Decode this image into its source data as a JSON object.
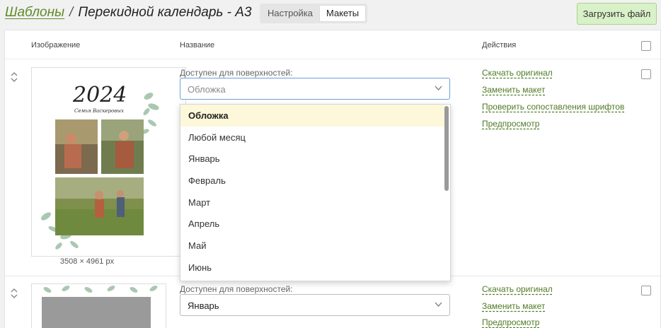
{
  "header": {
    "breadcrumb_root": "Шаблоны",
    "separator": "/",
    "title": "Перекидной календарь - А3",
    "tabs": [
      {
        "label": "Настройка",
        "active": false
      },
      {
        "label": "Макеты",
        "active": true
      }
    ],
    "upload_label": "Загрузить файл"
  },
  "table": {
    "columns": {
      "image": "Изображение",
      "name": "Название",
      "actions": "Действия"
    }
  },
  "rows": [
    {
      "image": {
        "year": "2024",
        "family": "Семья Васкеровых",
        "dims": "3508 × 4961 px"
      },
      "surface_label": "Доступен для поверхностей:",
      "select_placeholder": "Обложка",
      "actions": [
        "Скачать оригинал",
        "Заменить макет",
        "Проверить сопоставления шрифтов",
        "Предпросмотр"
      ]
    },
    {
      "surface_label": "Доступен для поверхностей:",
      "select_value": "Январь",
      "actions": [
        "Скачать оригинал",
        "Заменить макет",
        "Предпросмотр"
      ]
    }
  ],
  "dropdown": {
    "options": [
      "Обложка",
      "Любой месяц",
      "Январь",
      "Февраль",
      "Март",
      "Апрель",
      "Май",
      "Июнь"
    ],
    "highlighted": 0
  },
  "colors": {
    "link": "#4f7a24",
    "upload_bg": "#d9f1c8",
    "highlight": "#fcf8d9"
  }
}
